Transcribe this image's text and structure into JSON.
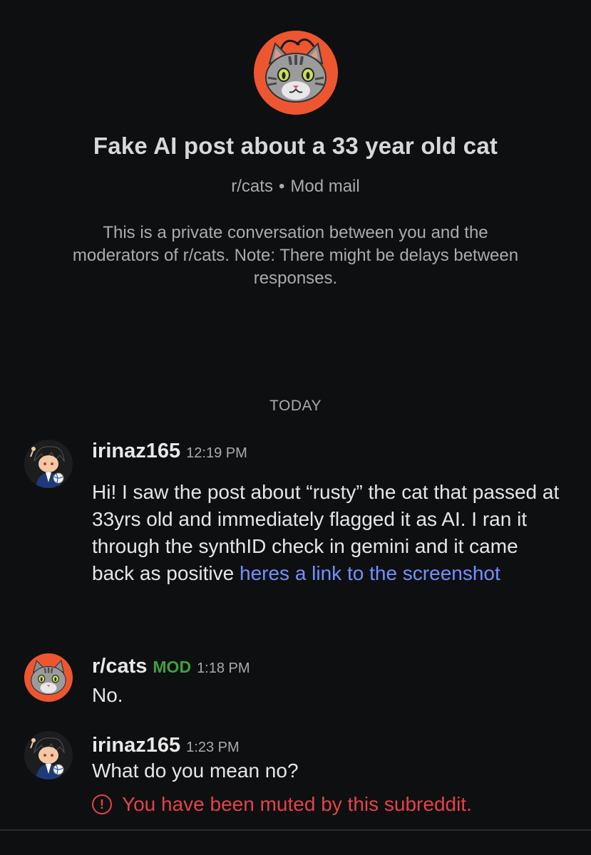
{
  "conversation": {
    "title": "Fake AI post about a 33 year old cat",
    "subreddit": "r/cats",
    "separator": "•",
    "type_label": "Mod mail",
    "notice": "This is a private conversation between you and the moderators of r/cats. Note: There might be delays between responses.",
    "subreddit_icon": "cat-face-icon"
  },
  "date_divider": "TODAY",
  "messages": [
    {
      "author": "irinaz165",
      "time": "12:19 PM",
      "avatar_icon": "user-avatar-icon",
      "text": "Hi! I saw the post about “rusty” the cat that passed at 33yrs old and immediately flagged it as AI. I ran it through the synthID check in gemini and it came back as positive ",
      "link_text": "heres a link to the screenshot"
    },
    {
      "author": "r/cats",
      "badge": "MOD",
      "time": "1:18 PM",
      "avatar_icon": "cat-face-icon",
      "text": "No."
    },
    {
      "author": "irinaz165",
      "time": "1:23 PM",
      "avatar_icon": "user-avatar-icon",
      "text": "What do you mean no?",
      "status": "You have been muted by this subreddit.",
      "status_icon": "warning-circle-icon"
    }
  ],
  "colors": {
    "background": "#0e0f10",
    "subreddit_accent": "#ee5630",
    "link": "#7390ff",
    "mod_badge": "#3fa03f",
    "error": "#e3434a"
  }
}
